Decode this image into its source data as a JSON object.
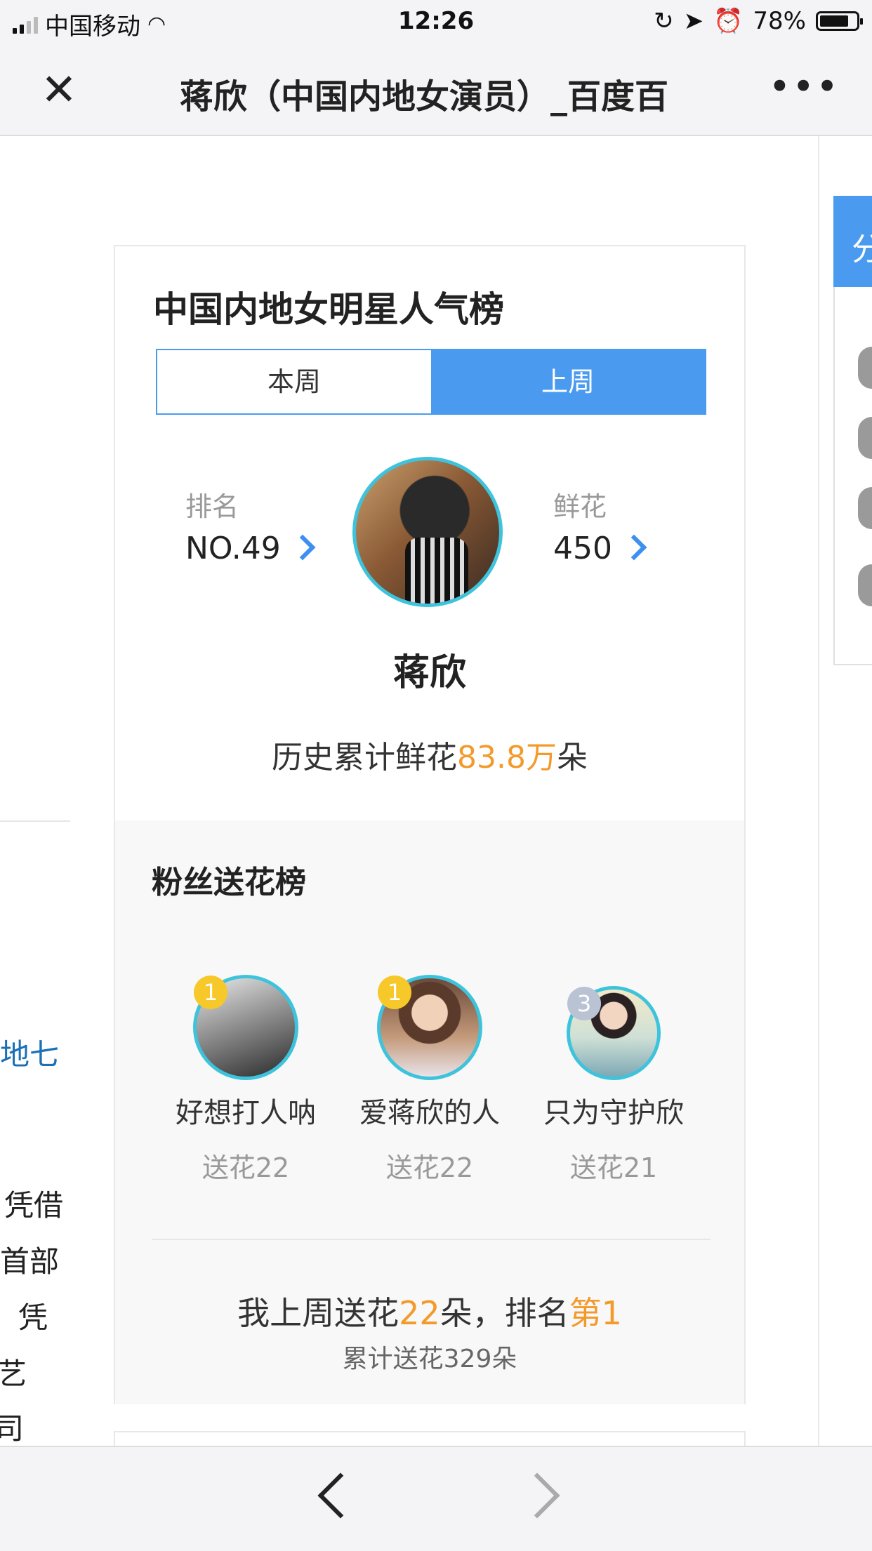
{
  "status_bar": {
    "carrier": "中国移动",
    "time": "12:26",
    "battery": "78%"
  },
  "nav": {
    "title": "蒋欣（中国内地女演员）_百度百",
    "more": "•••"
  },
  "left_fragments": [
    "地七",
    "凭借",
    "首部",
    "凭",
    "艺",
    "司"
  ],
  "right_tab": {
    "label": "分"
  },
  "ranking": {
    "title": "中国内地女明星人气榜",
    "tabs": [
      {
        "label": "本周",
        "active": false
      },
      {
        "label": "上周",
        "active": true
      }
    ],
    "rank_label": "排名",
    "rank_value": "NO.49",
    "flower_label": "鲜花",
    "flower_value": "450",
    "star_name": "蒋欣",
    "history_prefix": "历史累计鲜花",
    "history_value": "83.8万",
    "history_suffix": "朵"
  },
  "fans": {
    "title": "粉丝送花榜",
    "list": [
      {
        "rank": "1",
        "name": "好想打人呐",
        "gift": "送花22"
      },
      {
        "rank": "1",
        "name": "爱蒋欣的人",
        "gift": "送花22"
      },
      {
        "rank": "3",
        "name": "只为守护欣",
        "gift": "送花21"
      }
    ],
    "my_prefix": "我上周送花",
    "my_count": "22",
    "my_mid": "朵，排名",
    "my_rank": "第1",
    "my_total": "累计送花329朵"
  },
  "colors": {
    "accent": "#4a9bf0",
    "orange": "#f39a2b",
    "ring": "#3ec3dc",
    "gold": "#f6c829"
  }
}
